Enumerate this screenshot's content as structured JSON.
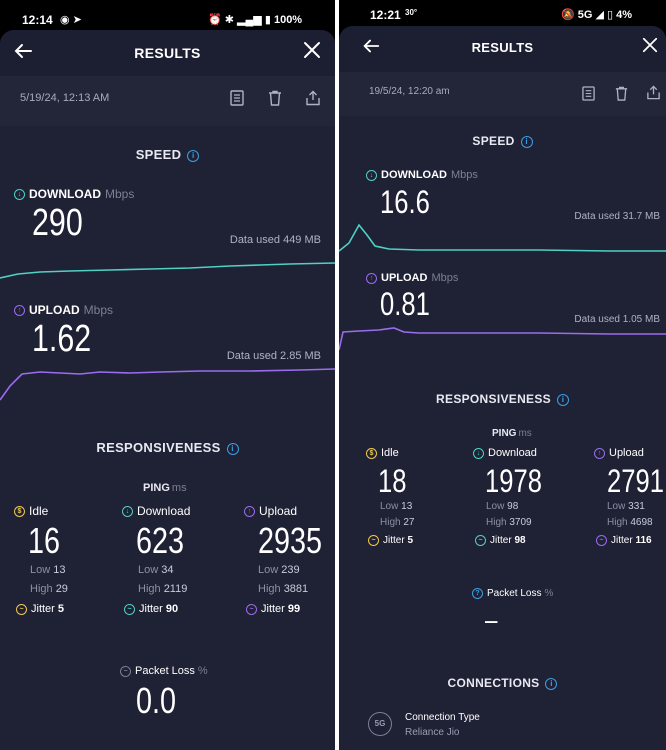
{
  "screens": [
    {
      "status_time": "12:14",
      "status_battery": "100%",
      "header_title": "RESULTS",
      "date": "5/19/24, 12:13 AM",
      "speed_title": "SPEED",
      "download_label": "DOWNLOAD",
      "download_unit": "Mbps",
      "download_value": "290",
      "download_data_used": "Data used 449 MB",
      "upload_label": "UPLOAD",
      "upload_unit": "Mbps",
      "upload_value": "1.62",
      "upload_data_used": "Data used 2.85 MB",
      "responsiveness_title": "RESPONSIVENESS",
      "ping_title": "PING",
      "ping_unit": "ms",
      "ping_columns": [
        {
          "label": "Idle",
          "value": "16",
          "low_label": "Low",
          "low": "13",
          "high_label": "High",
          "high": "29",
          "jitter_label": "Jitter",
          "jitter": "5"
        },
        {
          "label": "Download",
          "value": "623",
          "low_label": "Low",
          "low": "34",
          "high_label": "High",
          "high": "2119",
          "jitter_label": "Jitter",
          "jitter": "90"
        },
        {
          "label": "Upload",
          "value": "2935",
          "low_label": "Low",
          "low": "239",
          "high_label": "High",
          "high": "3881",
          "jitter_label": "Jitter",
          "jitter": "99"
        }
      ],
      "packet_loss_label": "Packet Loss",
      "packet_loss_unit": "%",
      "packet_loss_value": "0.0"
    },
    {
      "status_time": "12:21",
      "status_net": "5G",
      "status_battery": "4%",
      "header_title": "RESULTS",
      "date": "19/5/24, 12:20 am",
      "speed_title": "SPEED",
      "download_label": "DOWNLOAD",
      "download_unit": "Mbps",
      "download_value": "16.6",
      "download_data_used": "Data used 31.7 MB",
      "upload_label": "UPLOAD",
      "upload_unit": "Mbps",
      "upload_value": "0.81",
      "upload_data_used": "Data used 1.05 MB",
      "responsiveness_title": "RESPONSIVENESS",
      "ping_title": "PING",
      "ping_unit": "ms",
      "ping_columns": [
        {
          "label": "Idle",
          "value": "18",
          "low_label": "Low",
          "low": "13",
          "high_label": "High",
          "high": "27",
          "jitter_label": "Jitter",
          "jitter": "5"
        },
        {
          "label": "Download",
          "value": "1978",
          "low_label": "Low",
          "low": "98",
          "high_label": "High",
          "high": "3709",
          "jitter_label": "Jitter",
          "jitter": "98"
        },
        {
          "label": "Upload",
          "value": "2791",
          "low_label": "Low",
          "low": "331",
          "high_label": "High",
          "high": "4698",
          "jitter_label": "Jitter",
          "jitter": "116"
        }
      ],
      "packet_loss_label": "Packet Loss",
      "packet_loss_unit": "%",
      "packet_loss_value": "–",
      "connections_title": "CONNECTIONS",
      "connection_icon_text": "5G",
      "connection_type_label": "Connection Type",
      "connection_type_value": "Reliance Jio"
    }
  ],
  "colors": {
    "card_bg": "#1f2134",
    "download": "#4fd1c5",
    "upload": "#9b6cf0",
    "idle": "#f2c94c",
    "info": "#3aa0e5"
  }
}
